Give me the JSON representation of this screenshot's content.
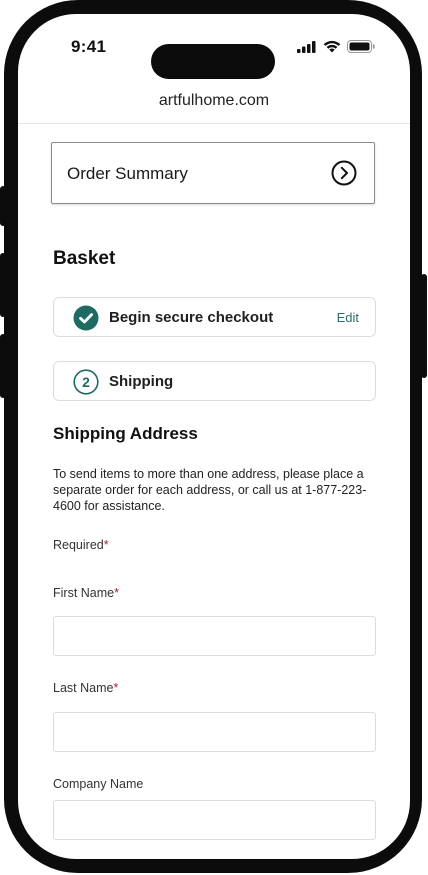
{
  "status_bar": {
    "time": "9:41",
    "icons": [
      "signal-icon",
      "wifi-icon",
      "battery-icon"
    ]
  },
  "browser": {
    "url": "artfulhome.com"
  },
  "order_summary": {
    "label": "Order Summary",
    "icon": "chevron-right-circle-icon"
  },
  "basket": {
    "title": "Basket"
  },
  "steps": [
    {
      "label": "Begin secure checkout",
      "status": "complete",
      "action": "Edit"
    },
    {
      "number": "2",
      "label": "Shipping",
      "status": "current"
    }
  ],
  "shipping": {
    "title": "Shipping Address",
    "notice": "To send items to more than one address, please place a separate order for each address, or call us at 1-877-223-4600 for assistance.",
    "required_label": "Required",
    "required_marker": "*",
    "fields": [
      {
        "label": "First Name",
        "required": "*",
        "value": ""
      },
      {
        "label": "Last Name",
        "required": "*",
        "value": ""
      },
      {
        "label": "Company Name",
        "required": "",
        "value": ""
      }
    ]
  },
  "colors": {
    "accent": "#1f6b63",
    "required": "#a4252b",
    "frame": "#0c0c0c"
  }
}
